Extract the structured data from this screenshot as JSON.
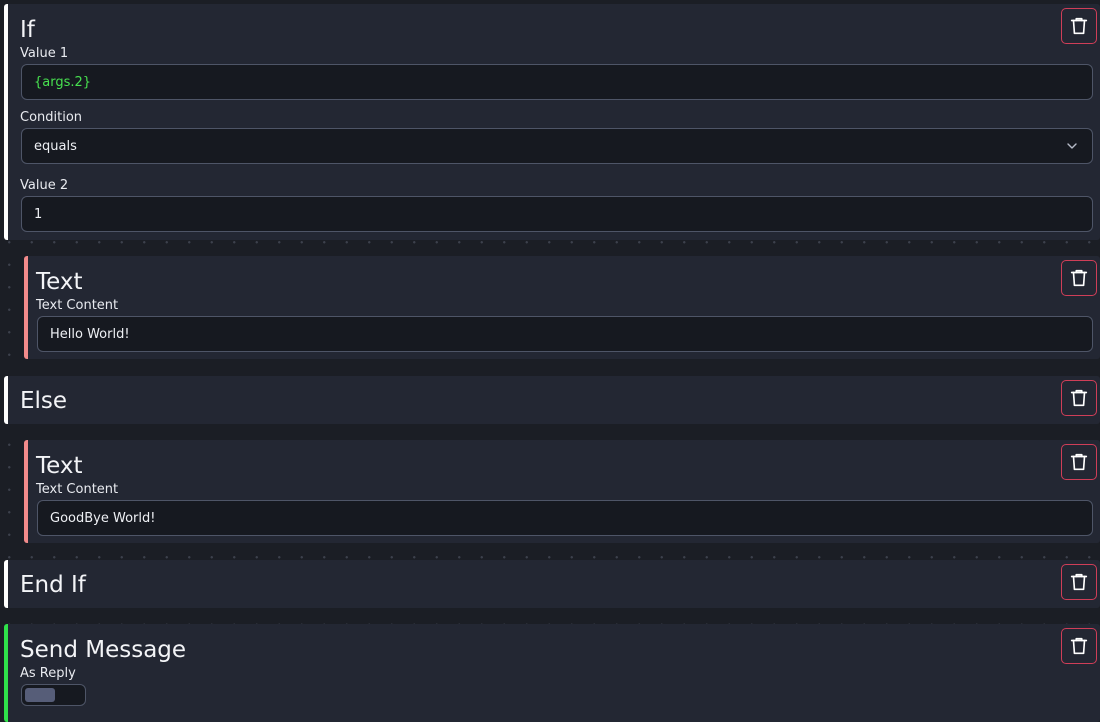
{
  "blocks": [
    {
      "id": "if",
      "title": "If",
      "fields": [
        {
          "label": "Value 1",
          "value": "{args.2}"
        },
        {
          "label": "Condition",
          "value": "equals"
        },
        {
          "label": "Value 2",
          "value": "1"
        }
      ]
    },
    {
      "id": "text-1",
      "title": "Text",
      "fields": [
        {
          "label": "Text Content",
          "value": "Hello World!"
        }
      ]
    },
    {
      "id": "else",
      "title": "Else"
    },
    {
      "id": "text-2",
      "title": "Text",
      "fields": [
        {
          "label": "Text Content",
          "value": "GoodBye World!"
        }
      ]
    },
    {
      "id": "end-if",
      "title": "End If"
    },
    {
      "id": "send-message",
      "title": "Send Message",
      "fields": [
        {
          "label": "As Reply",
          "toggle_on": false
        }
      ]
    }
  ],
  "colors": {
    "if_accent": "#ffffff",
    "text_accent": "#f28b8b",
    "send_accent": "#2fe24a",
    "delete_border": "#cf3e58",
    "variable_text": "#47e04f"
  },
  "icons": {
    "delete": "trash-icon",
    "condition_dropdown": "chevron-down-icon"
  }
}
